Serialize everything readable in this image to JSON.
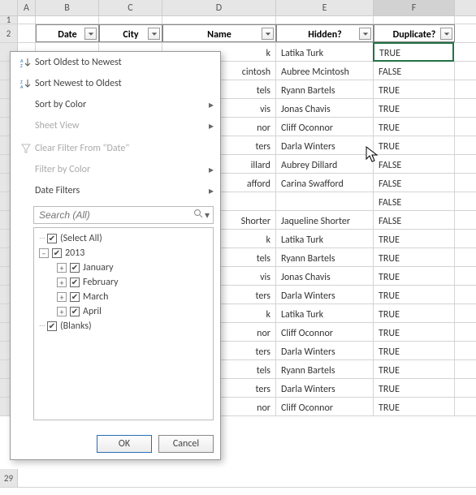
{
  "columns": {
    "A": "A",
    "B": "B",
    "C": "C",
    "D": "D",
    "E": "E",
    "F": "F"
  },
  "row_labels": {
    "r1": "1",
    "r2": "2",
    "r29": "29"
  },
  "headers": {
    "date": "Date",
    "city": "City",
    "name": "Name",
    "hidden": "Hidden?",
    "duplicate": "Duplicate?"
  },
  "rows": [
    {
      "d_frag": "k",
      "e": "Latika Turk",
      "f": "TRUE"
    },
    {
      "d_frag": "cintosh",
      "e": "Aubree Mcintosh",
      "f": "FALSE"
    },
    {
      "d_frag": "tels",
      "e": "Ryann Bartels",
      "f": "TRUE"
    },
    {
      "d_frag": "vis",
      "e": "Jonas Chavis",
      "f": "TRUE"
    },
    {
      "d_frag": "nor",
      "e": "Cliff Oconnor",
      "f": "TRUE"
    },
    {
      "d_frag": "ters",
      "e": "Darla Winters",
      "f": "TRUE"
    },
    {
      "d_frag": "illard",
      "e": "Aubrey Dillard",
      "f": "FALSE"
    },
    {
      "d_frag": "afford",
      "e": "Carina Swafford",
      "f": "FALSE"
    },
    {
      "d_frag": "",
      "e": "",
      "f": "FALSE"
    },
    {
      "d_frag": "Shorter",
      "e": "Jaqueline Shorter",
      "f": "FALSE"
    },
    {
      "d_frag": "k",
      "e": "Latika Turk",
      "f": "TRUE"
    },
    {
      "d_frag": "tels",
      "e": "Ryann Bartels",
      "f": "TRUE"
    },
    {
      "d_frag": "vis",
      "e": "Jonas Chavis",
      "f": "TRUE"
    },
    {
      "d_frag": "ters",
      "e": "Darla Winters",
      "f": "TRUE"
    },
    {
      "d_frag": "k",
      "e": "Latika Turk",
      "f": "TRUE"
    },
    {
      "d_frag": "nor",
      "e": "Cliff Oconnor",
      "f": "TRUE"
    },
    {
      "d_frag": "ters",
      "e": "Darla Winters",
      "f": "TRUE"
    },
    {
      "d_frag": "tels",
      "e": "Ryann Bartels",
      "f": "TRUE"
    },
    {
      "d_frag": "ters",
      "e": "Darla Winters",
      "f": "TRUE"
    },
    {
      "d_frag": "nor",
      "e": "Cliff Oconnor",
      "f": "TRUE"
    }
  ],
  "menu": {
    "sort_asc": "Sort Oldest to Newest",
    "sort_desc": "Sort Newest to Oldest",
    "sort_color": "Sort by Color",
    "sheet_view": "Sheet View",
    "clear_filter": "Clear Filter From \"Date\"",
    "filter_color": "Filter by Color",
    "date_filters": "Date Filters",
    "search_placeholder": "Search (All)",
    "ok": "OK",
    "cancel": "Cancel"
  },
  "tree": {
    "select_all": "(Select All)",
    "year": "2013",
    "months": [
      "January",
      "February",
      "March",
      "April"
    ],
    "blanks": "(Blanks)"
  }
}
